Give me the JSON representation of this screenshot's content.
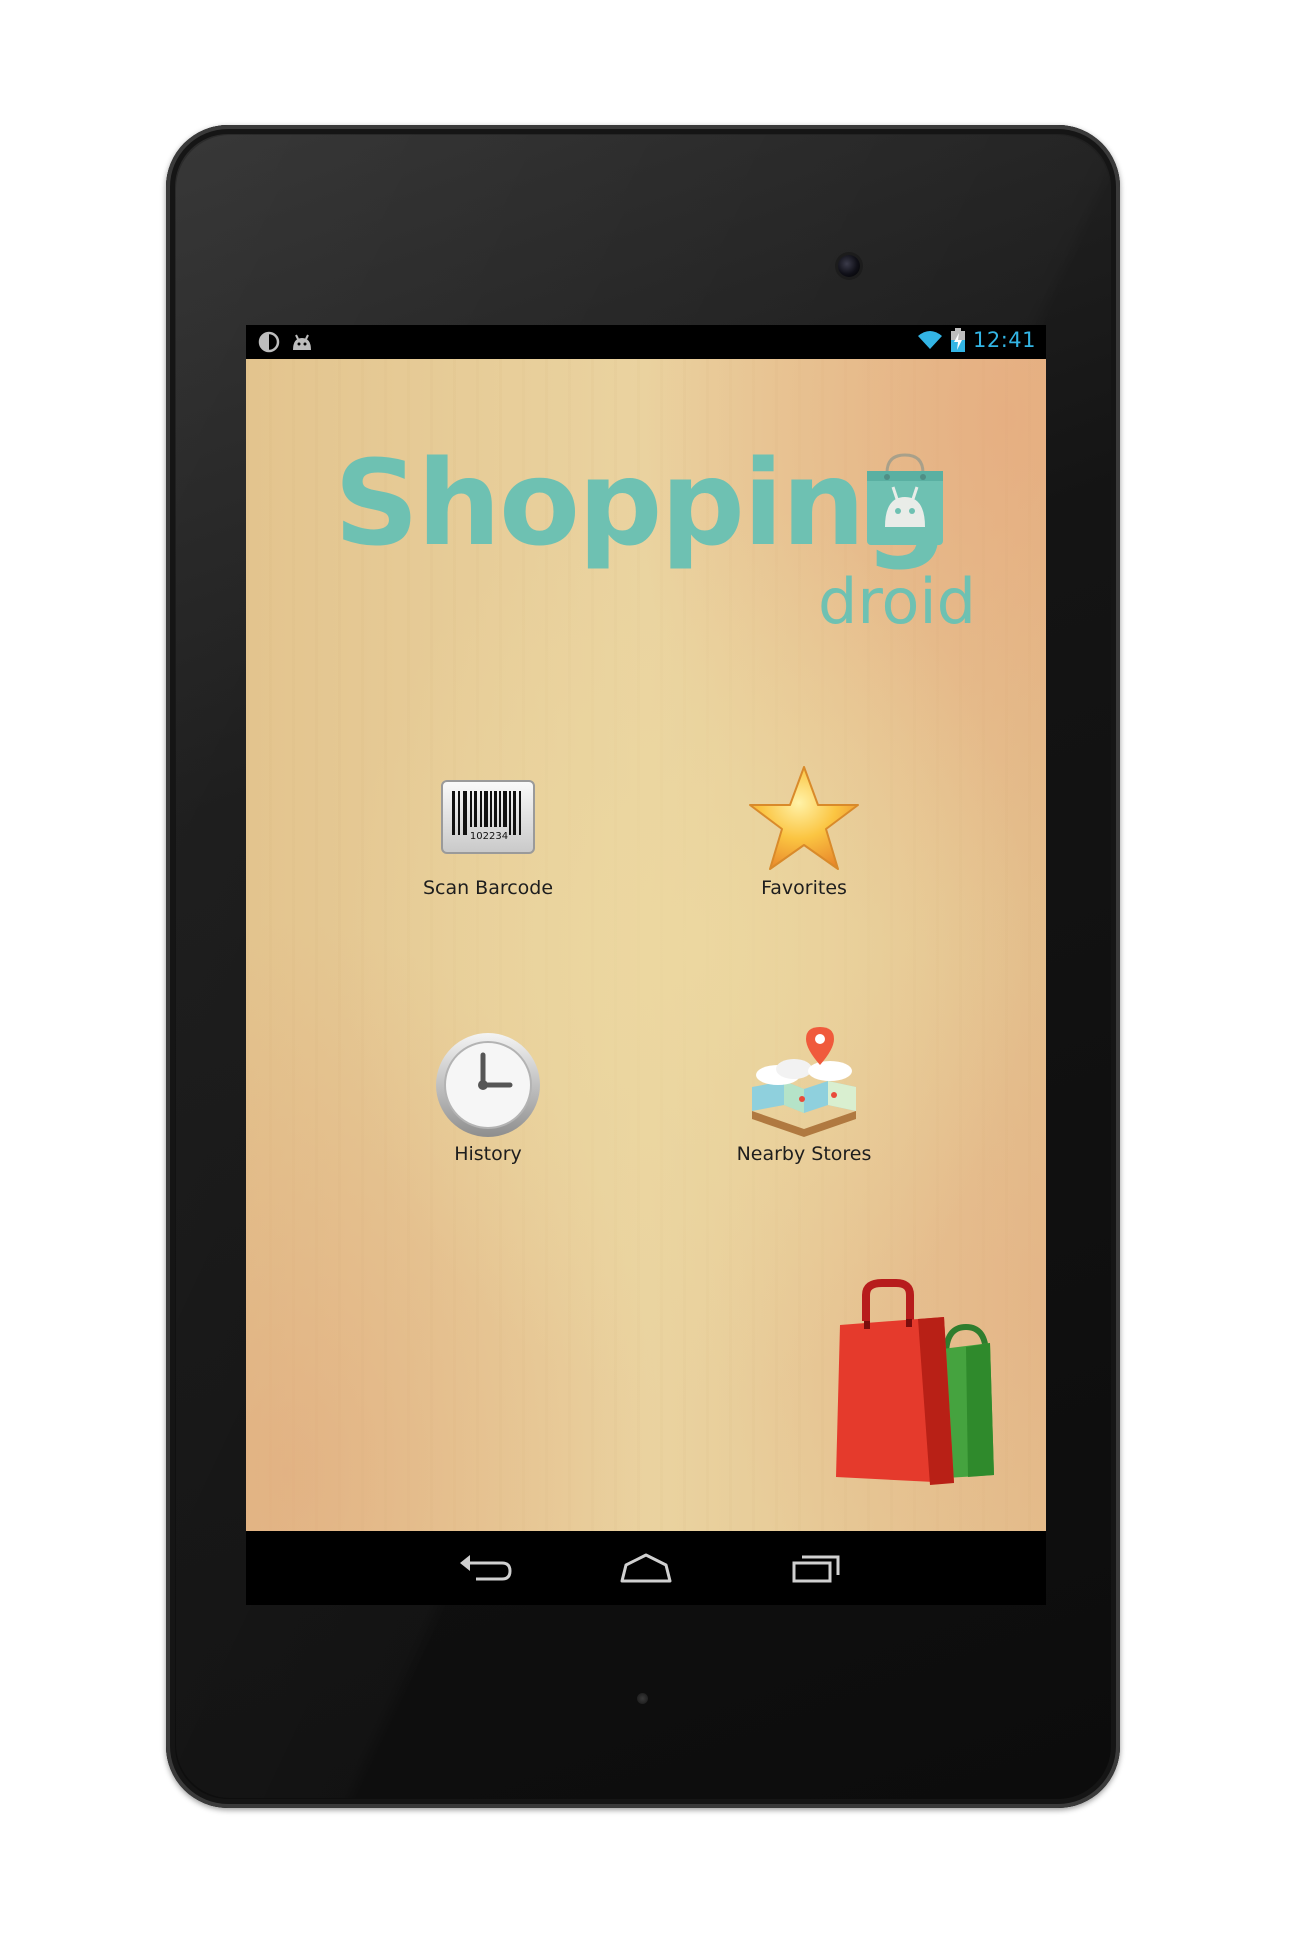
{
  "status_bar": {
    "time": "12:41",
    "icons": [
      "half-moon-icon",
      "android-icon",
      "wifi-icon",
      "battery-charging-icon"
    ],
    "accent_color": "#33b5e5"
  },
  "app": {
    "logo_main": "Shopping",
    "logo_sub": "droid",
    "logo_color": "#6ec1b2"
  },
  "menu": {
    "items": [
      {
        "label": "Scan Barcode",
        "icon": "barcode-icon",
        "barcode_number": "102234"
      },
      {
        "label": "Favorites",
        "icon": "star-icon"
      },
      {
        "label": "History",
        "icon": "clock-icon"
      },
      {
        "label": "Nearby Stores",
        "icon": "map-pin-icon"
      }
    ]
  },
  "nav_bar": {
    "buttons": [
      "back-icon",
      "home-icon",
      "recent-apps-icon"
    ]
  }
}
